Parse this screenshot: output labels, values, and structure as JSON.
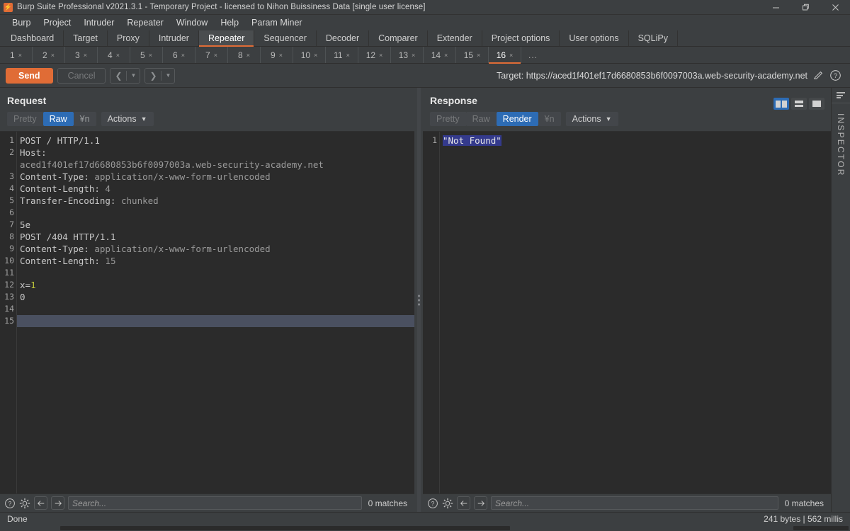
{
  "window": {
    "title": "Burp Suite Professional v2021.3.1 - Temporary Project - licensed to Nihon Buissiness Data [single user license]",
    "logo_icon": "burp-logo-icon",
    "minimize_icon": "minimize-icon",
    "restore_icon": "restore-icon",
    "close_icon": "close-icon"
  },
  "menubar": {
    "items": [
      {
        "label": "Burp"
      },
      {
        "label": "Project"
      },
      {
        "label": "Intruder"
      },
      {
        "label": "Repeater"
      },
      {
        "label": "Window"
      },
      {
        "label": "Help"
      },
      {
        "label": "Param Miner"
      }
    ]
  },
  "main_tabs": {
    "active": "Repeater",
    "items": [
      {
        "label": "Dashboard",
        "active": false
      },
      {
        "label": "Target",
        "active": false
      },
      {
        "label": "Proxy",
        "active": false
      },
      {
        "label": "Intruder",
        "active": false
      },
      {
        "label": "Repeater",
        "active": true
      },
      {
        "label": "Sequencer",
        "active": false
      },
      {
        "label": "Decoder",
        "active": false
      },
      {
        "label": "Comparer",
        "active": false
      },
      {
        "label": "Extender",
        "active": false
      },
      {
        "label": "Project options",
        "active": false
      },
      {
        "label": "User options",
        "active": false
      },
      {
        "label": "SQLiPy",
        "active": false
      }
    ]
  },
  "repeater_tabs": {
    "active": "16",
    "close_glyph": "×",
    "more_label": "...",
    "items": [
      {
        "label": "1",
        "active": false
      },
      {
        "label": "2",
        "active": false
      },
      {
        "label": "3",
        "active": false
      },
      {
        "label": "4",
        "active": false
      },
      {
        "label": "5",
        "active": false
      },
      {
        "label": "6",
        "active": false
      },
      {
        "label": "7",
        "active": false
      },
      {
        "label": "8",
        "active": false
      },
      {
        "label": "9",
        "active": false
      },
      {
        "label": "10",
        "active": false
      },
      {
        "label": "11",
        "active": false
      },
      {
        "label": "12",
        "active": false
      },
      {
        "label": "13",
        "active": false
      },
      {
        "label": "14",
        "active": false
      },
      {
        "label": "15",
        "active": false
      },
      {
        "label": "16",
        "active": true
      }
    ]
  },
  "toolbar": {
    "send_label": "Send",
    "cancel_label": "Cancel",
    "back_icon": "chevron-left-icon",
    "forward_icon": "chevron-right-icon",
    "dropdown_icon": "caret-down-icon",
    "target_label": "Target: https://aced1f401ef17d6680853b6f0097003a.web-security-academy.net",
    "edit_icon": "pencil-icon",
    "help_icon": "question-circle-icon"
  },
  "layout_buttons": {
    "split_icon": "layout-side-by-side-icon",
    "stack_icon": "layout-stacked-icon",
    "single_icon": "layout-single-icon",
    "active": "split"
  },
  "request": {
    "title": "Request",
    "tabs": [
      {
        "label": "Pretty",
        "active": false,
        "dim": true
      },
      {
        "label": "Raw",
        "active": true,
        "dim": false
      },
      {
        "label": "¥n",
        "active": false,
        "dim": false
      }
    ],
    "actions_label": "Actions",
    "lines": [
      {
        "no": "1",
        "segments": [
          {
            "t": "POST / HTTP/1.1",
            "cls": "tok-hdr"
          }
        ]
      },
      {
        "no": "2",
        "segments": [
          {
            "t": "Host:",
            "cls": "tok-hdr"
          }
        ]
      },
      {
        "no": "",
        "segments": [
          {
            "t": "aced1f401ef17d6680853b6f0097003a.web-security-academy.net",
            "cls": "tok-val"
          }
        ]
      },
      {
        "no": "3",
        "segments": [
          {
            "t": "Content-Type: ",
            "cls": "tok-hdr"
          },
          {
            "t": "application/x-www-form-urlencoded",
            "cls": "tok-val"
          }
        ]
      },
      {
        "no": "4",
        "segments": [
          {
            "t": "Content-Length: ",
            "cls": "tok-hdr"
          },
          {
            "t": "4",
            "cls": "tok-val"
          }
        ]
      },
      {
        "no": "5",
        "segments": [
          {
            "t": "Transfer-Encoding: ",
            "cls": "tok-hdr"
          },
          {
            "t": "chunked",
            "cls": "tok-val"
          }
        ]
      },
      {
        "no": "6",
        "segments": [
          {
            "t": "",
            "cls": "tok-hdr"
          }
        ]
      },
      {
        "no": "7",
        "segments": [
          {
            "t": "5e",
            "cls": "tok-hdr"
          }
        ]
      },
      {
        "no": "8",
        "segments": [
          {
            "t": "POST /404 HTTP/1.1",
            "cls": "tok-hdr"
          }
        ]
      },
      {
        "no": "9",
        "segments": [
          {
            "t": "Content-Type: ",
            "cls": "tok-hdr"
          },
          {
            "t": "application/x-www-form-urlencoded",
            "cls": "tok-val"
          }
        ]
      },
      {
        "no": "10",
        "segments": [
          {
            "t": "Content-Length: ",
            "cls": "tok-hdr"
          },
          {
            "t": "15",
            "cls": "tok-val"
          }
        ]
      },
      {
        "no": "11",
        "segments": [
          {
            "t": "",
            "cls": "tok-hdr"
          }
        ]
      },
      {
        "no": "12",
        "segments": [
          {
            "t": "x=",
            "cls": "tok-hdr"
          },
          {
            "t": "1",
            "cls": "tok-num"
          }
        ]
      },
      {
        "no": "13",
        "segments": [
          {
            "t": "0",
            "cls": "tok-hdr"
          }
        ]
      },
      {
        "no": "14",
        "segments": [
          {
            "t": "",
            "cls": "tok-hdr"
          }
        ]
      },
      {
        "no": "15",
        "segments": [
          {
            "t": "",
            "cls": "tok-hdr"
          }
        ],
        "cursor": true
      }
    ],
    "find": {
      "help_icon": "question-circle-icon",
      "settings_icon": "gear-icon",
      "prev_icon": "arrow-left-icon",
      "next_icon": "arrow-right-icon",
      "placeholder": "Search...",
      "value": "",
      "matches": "0 matches"
    }
  },
  "response": {
    "title": "Response",
    "tabs": [
      {
        "label": "Pretty",
        "active": false,
        "dim": true
      },
      {
        "label": "Raw",
        "active": false,
        "dim": true
      },
      {
        "label": "Render",
        "active": true,
        "dim": false
      },
      {
        "label": "¥n",
        "active": false,
        "dim": true
      }
    ],
    "actions_label": "Actions",
    "lines": [
      {
        "no": "1",
        "text": "\"Not Found\"",
        "selected": true
      }
    ],
    "find": {
      "help_icon": "question-circle-icon",
      "settings_icon": "gear-icon",
      "prev_icon": "arrow-left-icon",
      "next_icon": "arrow-right-icon",
      "placeholder": "Search...",
      "value": "",
      "matches": "0 matches"
    }
  },
  "inspector": {
    "label": "INSPECTOR",
    "menu_icon": "hamburger-menu-icon"
  },
  "statusbar": {
    "left": "Done",
    "right": "241 bytes | 562 millis"
  },
  "colors": {
    "accent_orange": "#e06c36",
    "accent_blue": "#2d6cb5",
    "bg_chrome": "#3c3f41",
    "bg_editor": "#2b2b2b",
    "cursor_line": "#4a5060",
    "selection": "#343a8c",
    "value_yellow": "#c2c93c"
  }
}
